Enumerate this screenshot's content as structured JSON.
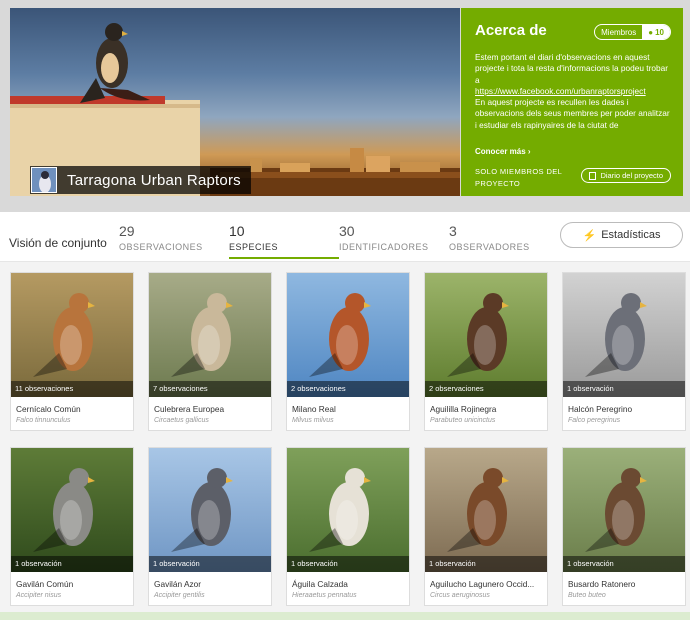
{
  "project": {
    "title": "Tarragona Urban Raptors",
    "about": {
      "heading": "Acerca de",
      "members_label": "Miembros",
      "members_count": "10",
      "description": "Estem portant el diari d'observacions en aquest projecte i tota la resta d'informacions la podeu trobar a",
      "link": "https://www.facebook.com/urbanraptorsproject",
      "description_cont": "En aquest projecte es recullen les dades i observacions dels seus membres per poder analitzar i estudiar els rapinyaires de la ciutat de",
      "more": "Conocer más ›",
      "members_only": "SOLO MIEMBROS DEL PROYECTO",
      "diary_button": "Diario del proyecto"
    }
  },
  "stats": {
    "overview_label": "Visión de conjunto",
    "items": [
      {
        "num": "29",
        "label": "OBSERVACIONES"
      },
      {
        "num": "10",
        "label": "ESPECIES"
      },
      {
        "num": "30",
        "label": "IDENTIFICADORES"
      },
      {
        "num": "3",
        "label": "OBSERVADORES"
      }
    ],
    "stats_button": "Estadísticas"
  },
  "species": [
    {
      "common": "Cernícalo Común",
      "scientific": "Falco tinnunculus",
      "obs": "11 observaciones"
    },
    {
      "common": "Culebrera Europea",
      "scientific": "Circaetus gallicus",
      "obs": "7 observaciones"
    },
    {
      "common": "Milano Real",
      "scientific": "Milvus milvus",
      "obs": "2 observaciones"
    },
    {
      "common": "Aguililla Rojinegra",
      "scientific": "Parabuteo unicinctus",
      "obs": "2 observaciones"
    },
    {
      "common": "Halcón Peregrino",
      "scientific": "Falco peregrinus",
      "obs": "1 observación"
    },
    {
      "common": "Gavilán Común",
      "scientific": "Accipiter nisus",
      "obs": "1 observación"
    },
    {
      "common": "Gavilán Azor",
      "scientific": "Accipiter gentilis",
      "obs": "1 observación"
    },
    {
      "common": "Águila Calzada",
      "scientific": "Hieraaetus pennatus",
      "obs": "1 observación"
    },
    {
      "common": "Aguilucho Lagunero Occid...",
      "scientific": "Circus aeruginosus",
      "obs": "1 observación"
    },
    {
      "common": "Busardo Ratonero",
      "scientific": "Buteo buteo",
      "obs": "1 observación"
    }
  ],
  "colors": {
    "accent": "#74ac00"
  }
}
